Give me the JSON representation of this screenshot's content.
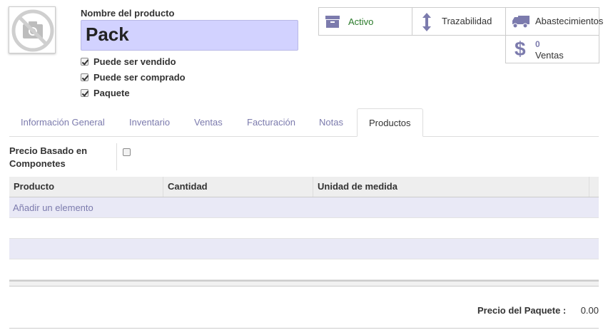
{
  "product": {
    "name_label": "Nombre del producto",
    "name_value": "Pack",
    "image_icon": "camera-off-icon"
  },
  "options": [
    {
      "label": "Puede ser vendido",
      "checked": true
    },
    {
      "label": "Puede ser comprado",
      "checked": true
    },
    {
      "label": "Paquete",
      "checked": true
    }
  ],
  "smart_buttons": {
    "active": {
      "label": "Activo",
      "icon": "archive-icon",
      "color": "#2a7a2a"
    },
    "traceability": {
      "label": "Trazabilidad",
      "icon": "arrows-vertical-icon"
    },
    "procurement": {
      "label": "Abastecimientos",
      "icon": "truck-icon"
    },
    "sales": {
      "count": "0",
      "label": "Ventas",
      "icon": "dollar-icon"
    }
  },
  "tabs": [
    {
      "label": "Información General"
    },
    {
      "label": "Inventario"
    },
    {
      "label": "Ventas"
    },
    {
      "label": "Facturación"
    },
    {
      "label": "Notas"
    },
    {
      "label": "Productos",
      "active": true
    }
  ],
  "component_price": {
    "label": "Precio Basado en Componetes",
    "checked": false
  },
  "components_table": {
    "columns": [
      "Producto",
      "Cantidad",
      "Unidad de medida"
    ],
    "add_line_label": "Añadir un elemento",
    "rows": []
  },
  "package_price": {
    "label": "Precio del Paquete :",
    "value": "0.00"
  },
  "colors": {
    "accent": "#7c7bad",
    "input_bg": "#d2d2ff",
    "row_alt": "#e9e9f6"
  }
}
